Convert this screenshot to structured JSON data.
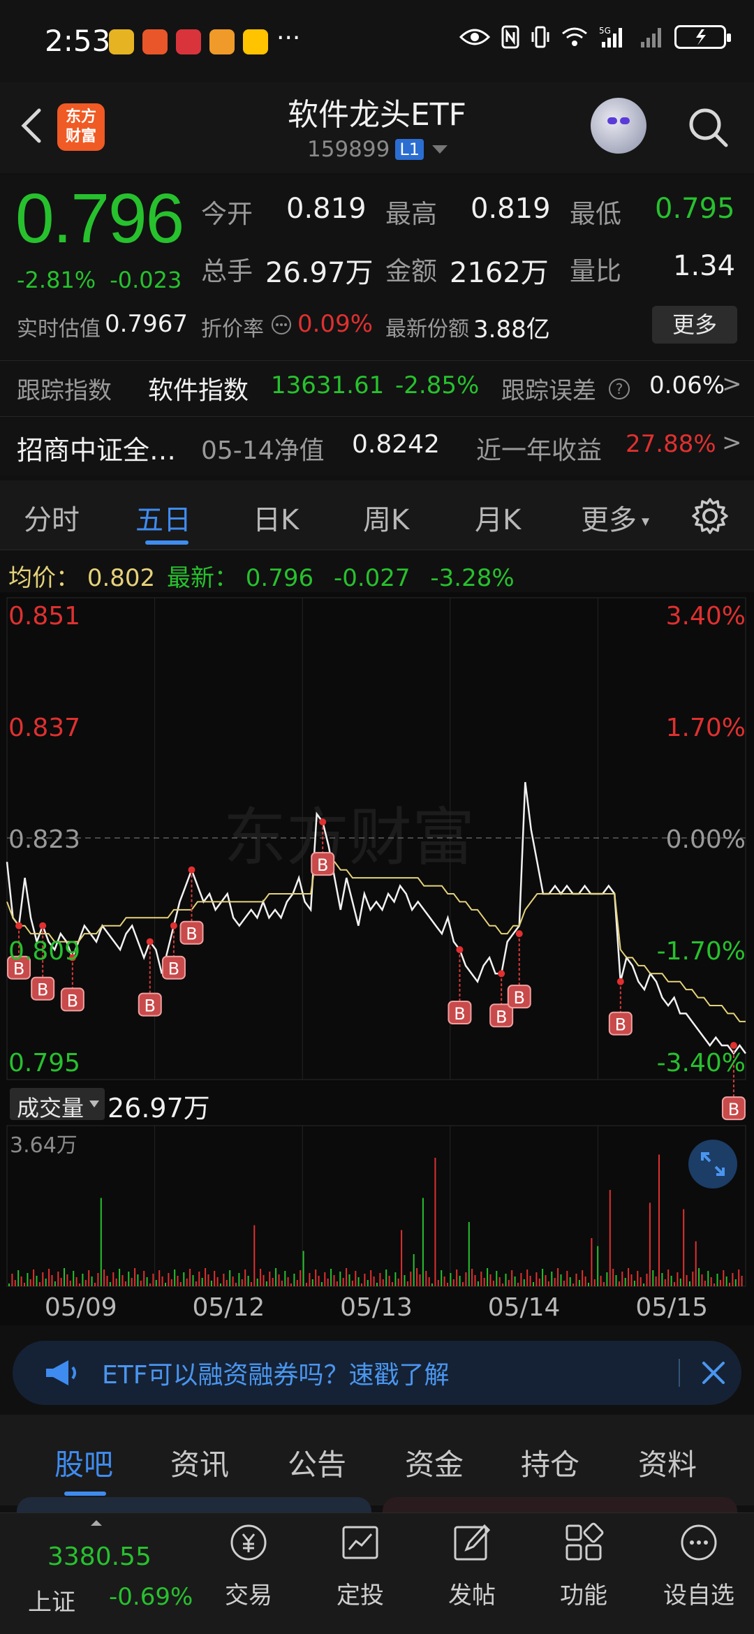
{
  "status_bar": {
    "time": "2:53",
    "dots": "···",
    "network": "5G"
  },
  "header": {
    "back_icon": "chevron-left-icon",
    "logo_text": "东方\n财富",
    "title": "软件龙头ETF",
    "code": "159899",
    "level": "L1"
  },
  "quote": {
    "price": "0.796",
    "change_pct": "-2.81%",
    "change": "-0.023",
    "open_label": "今开",
    "open": "0.819",
    "high_label": "最高",
    "high": "0.819",
    "low_label": "最低",
    "low": "0.795",
    "volume_label": "总手",
    "volume": "26.97万",
    "amount_label": "金额",
    "amount": "2162万",
    "ratio_label": "量比",
    "ratio": "1.34",
    "iopv_label": "实时估值",
    "iopv": "0.7967",
    "discount_label": "折价率",
    "discount": "0.09%",
    "shares_label": "最新份额",
    "shares": "3.88亿",
    "more_button": "更多",
    "track_label": "跟踪指数",
    "track_name": "软件指数",
    "track_value": "13631.61",
    "track_change": "-2.85%",
    "error_label": "跟踪误差",
    "error_value": "0.06%",
    "fund_name": "招商中证全…",
    "nav_label": "05-14净值",
    "nav_value": "0.8242",
    "year_label": "近一年收益",
    "year_value": "27.88%"
  },
  "tabs": [
    "分时",
    "五日",
    "日K",
    "周K",
    "月K",
    "更多"
  ],
  "active_tab": "五日",
  "chart_info": {
    "avg_label": "均价：",
    "avg_value": "0.802",
    "latest_label": "最新：",
    "latest_value": "0.796",
    "latest_change": "-0.027",
    "latest_change_pct": "-3.28%",
    "watermark": "东方财富"
  },
  "chart_data": {
    "type": "line",
    "title": "",
    "y_left_ticks": [
      "0.851",
      "0.837",
      "0.823",
      "0.809",
      "0.795"
    ],
    "y_right_ticks": [
      "3.40%",
      "1.70%",
      "0.00%",
      "-1.70%",
      "-3.40%"
    ],
    "ylim": [
      0.795,
      0.851
    ],
    "reference": 0.823,
    "x_labels": [
      "05/09",
      "05/12",
      "05/13",
      "05/14",
      "05/15"
    ],
    "series": [
      {
        "name": "price",
        "values": [
          0.82,
          0.813,
          0.812,
          0.818,
          0.813,
          0.81,
          0.812,
          0.81,
          0.809,
          0.811,
          0.81,
          0.808,
          0.81,
          0.812,
          0.811,
          0.81,
          0.812,
          0.811,
          0.81,
          0.809,
          0.811,
          0.812,
          0.81,
          0.808,
          0.81,
          0.809,
          0.806,
          0.809,
          0.812,
          0.815,
          0.817,
          0.819,
          0.817,
          0.815,
          0.816,
          0.814,
          0.815,
          0.816,
          0.813,
          0.812,
          0.813,
          0.814,
          0.813,
          0.815,
          0.813,
          0.814,
          0.813,
          0.815,
          0.816,
          0.818,
          0.815,
          0.814,
          0.826,
          0.825,
          0.822,
          0.818,
          0.814,
          0.818,
          0.815,
          0.812,
          0.816,
          0.814,
          0.815,
          0.814,
          0.816,
          0.815,
          0.817,
          0.816,
          0.814,
          0.815,
          0.814,
          0.813,
          0.812,
          0.811,
          0.813,
          0.81,
          0.809,
          0.807,
          0.806,
          0.805,
          0.807,
          0.808,
          0.806,
          0.806,
          0.81,
          0.811,
          0.812,
          0.83,
          0.824,
          0.82,
          0.816,
          0.816,
          0.817,
          0.816,
          0.817,
          0.816,
          0.816,
          0.817,
          0.816,
          0.816,
          0.816,
          0.817,
          0.816,
          0.805,
          0.808,
          0.807,
          0.805,
          0.804,
          0.806,
          0.805,
          0.803,
          0.802,
          0.803,
          0.801,
          0.801,
          0.8,
          0.799,
          0.798,
          0.797,
          0.798,
          0.797,
          0.797,
          0.796,
          0.797,
          0.796
        ]
      },
      {
        "name": "average",
        "values": [
          0.815,
          0.813,
          0.812,
          0.812,
          0.811,
          0.811,
          0.811,
          0.811,
          0.81,
          0.81,
          0.81,
          0.81,
          0.81,
          0.811,
          0.811,
          0.811,
          0.812,
          0.812,
          0.812,
          0.812,
          0.813,
          0.813,
          0.813,
          0.813,
          0.813,
          0.813,
          0.813,
          0.813,
          0.814,
          0.814,
          0.814,
          0.814,
          0.815,
          0.815,
          0.815,
          0.815,
          0.815,
          0.815,
          0.815,
          0.815,
          0.815,
          0.815,
          0.815,
          0.815,
          0.816,
          0.816,
          0.816,
          0.816,
          0.816,
          0.816,
          0.816,
          0.816,
          0.821,
          0.821,
          0.82,
          0.82,
          0.819,
          0.819,
          0.818,
          0.818,
          0.818,
          0.818,
          0.818,
          0.818,
          0.818,
          0.818,
          0.818,
          0.818,
          0.818,
          0.818,
          0.817,
          0.817,
          0.817,
          0.817,
          0.816,
          0.816,
          0.815,
          0.815,
          0.814,
          0.814,
          0.813,
          0.812,
          0.812,
          0.811,
          0.811,
          0.812,
          0.812,
          0.814,
          0.815,
          0.816,
          0.816,
          0.816,
          0.816,
          0.816,
          0.816,
          0.816,
          0.816,
          0.816,
          0.816,
          0.816,
          0.816,
          0.816,
          0.816,
          0.809,
          0.808,
          0.808,
          0.807,
          0.807,
          0.806,
          0.806,
          0.806,
          0.805,
          0.805,
          0.805,
          0.804,
          0.804,
          0.803,
          0.803,
          0.802,
          0.802,
          0.802,
          0.801,
          0.801,
          0.8,
          0.8
        ]
      }
    ],
    "buy_markers": [
      {
        "index": 2,
        "price": 0.812
      },
      {
        "index": 6,
        "price": 0.812
      },
      {
        "index": 11,
        "price": 0.808
      },
      {
        "index": 24,
        "price": 0.81
      },
      {
        "index": 28,
        "price": 0.812
      },
      {
        "index": 31,
        "price": 0.819
      },
      {
        "index": 53,
        "price": 0.825
      },
      {
        "index": 76,
        "price": 0.809
      },
      {
        "index": 83,
        "price": 0.806
      },
      {
        "index": 86,
        "price": 0.811
      },
      {
        "index": 103,
        "price": 0.805
      },
      {
        "index": 122,
        "price": 0.797
      }
    ],
    "buy_label": "B"
  },
  "volume": {
    "label": "成交量",
    "value": "26.97万",
    "max_tick": "3.64万"
  },
  "banner": {
    "text": "ETF可以融资融券吗？速戳了解"
  },
  "bottom_tabs": [
    "股吧",
    "资讯",
    "公告",
    "资金",
    "持仓",
    "资料"
  ],
  "active_bottom_tab": "股吧",
  "bottom_nav": {
    "index_value": "3380.55",
    "index_name": "上证",
    "index_change": "-0.69%",
    "items": [
      "交易",
      "定投",
      "发帖",
      "功能",
      "设自选"
    ]
  },
  "colors": {
    "up": "#e03030",
    "down": "#27c12e",
    "accent": "#3f8cf0",
    "avg": "#e6d27a"
  }
}
